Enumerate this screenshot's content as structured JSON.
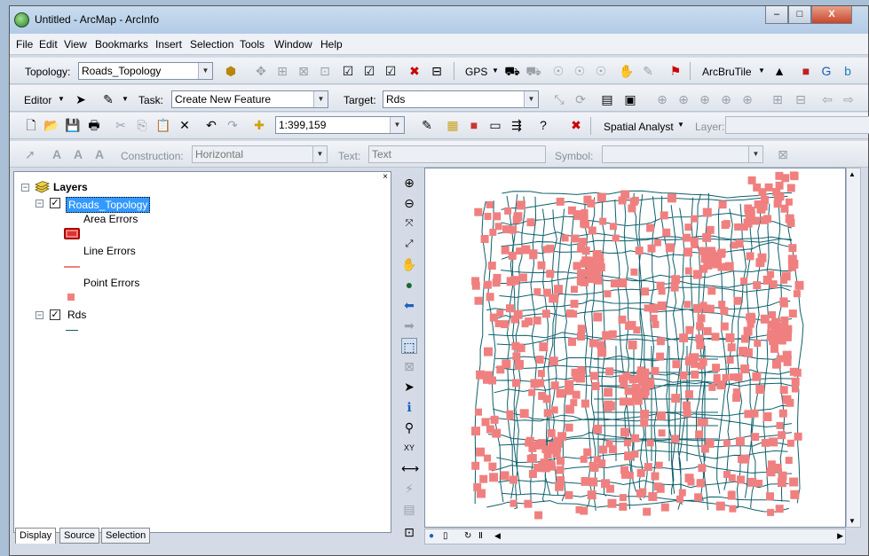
{
  "window": {
    "title": "Untitled - ArcMap - ArcInfo"
  },
  "caption": {
    "minimize": "–",
    "maximize": "□",
    "close": "X"
  },
  "menu": [
    "File",
    "Edit",
    "View",
    "Bookmarks",
    "Insert",
    "Selection",
    "Tools",
    "Window",
    "Help"
  ],
  "topology_toolbar": {
    "label": "Topology:",
    "value": "Roads_Topology",
    "gps": "GPS",
    "arcbrutile": "ArcBruTile"
  },
  "editor_toolbar": {
    "editor": "Editor",
    "task_label": "Task:",
    "task_value": "Create New Feature",
    "target_label": "Target:",
    "target_value": "Rds"
  },
  "standard_toolbar": {
    "scale": "1:399,159",
    "spatial_analyst": "Spatial Analyst",
    "layer_label": "Layer:"
  },
  "annotation_toolbar": {
    "construction_label": "Construction:",
    "construction_value": "Horizontal",
    "text_label": "Text:",
    "text_value": "Text",
    "symbol_label": "Symbol:"
  },
  "toc": {
    "root": "Layers",
    "layers": [
      {
        "name": "Roads_Topology",
        "checked": true,
        "selected": true,
        "legend": [
          "Area Errors",
          "Line Errors",
          "Point Errors"
        ]
      },
      {
        "name": "Rds",
        "checked": true
      }
    ],
    "tabs": [
      "Display",
      "Source",
      "Selection"
    ]
  },
  "colors": {
    "road": "#0e5f6b",
    "error": "#f08080",
    "selection": "#3399ff"
  },
  "icons": [
    "zoom-in-icon",
    "zoom-out-icon",
    "fixed-zoom-in-icon",
    "fixed-zoom-out-icon",
    "pan-icon",
    "full-extent-icon",
    "back-icon",
    "forward-icon",
    "select-features-icon",
    "clear-selection-icon",
    "select-elements-icon",
    "identify-icon",
    "find-icon",
    "go-to-xy-icon",
    "measure-icon",
    "hyperlink-icon",
    "html-popup-icon",
    "swipe-icon"
  ]
}
